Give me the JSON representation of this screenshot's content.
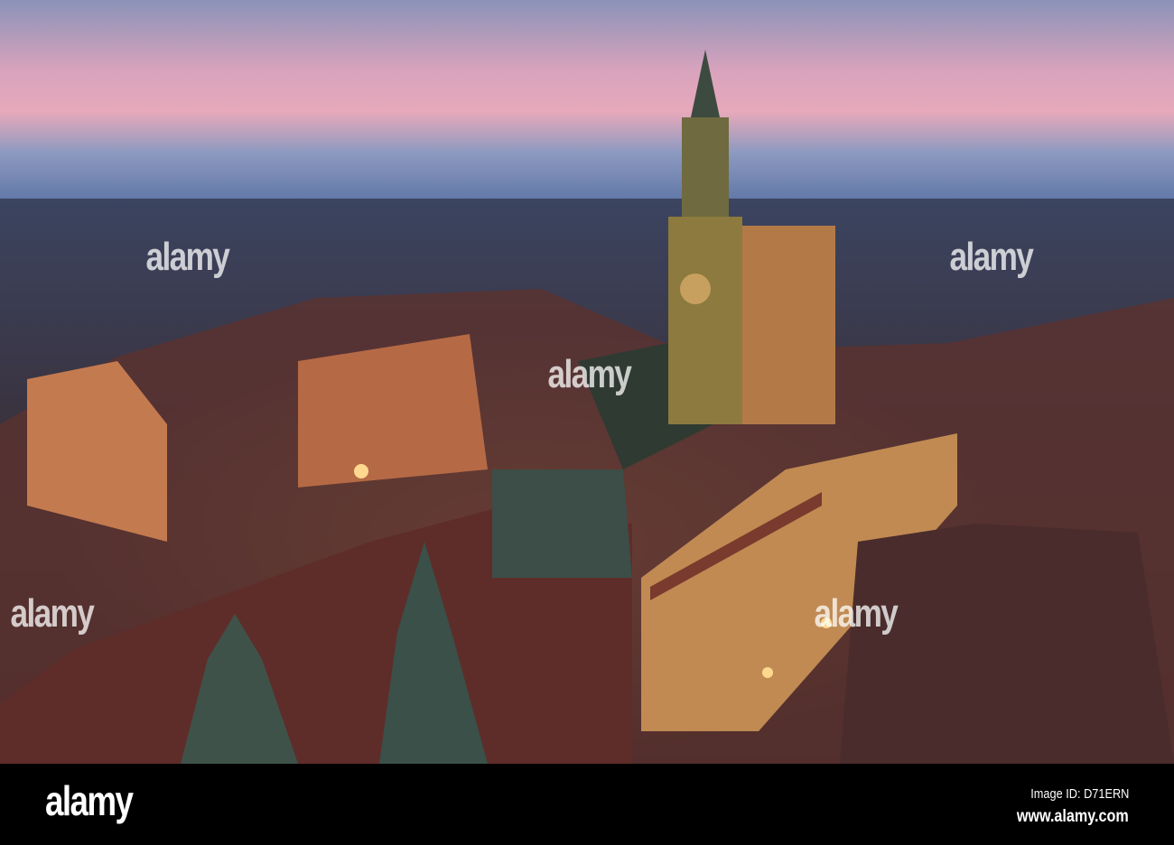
{
  "photo": {
    "subject": "Wroclaw old town at dusk with town hall tower",
    "colors": {
      "sky_top": "#7f8fb4",
      "sky_pink": "#e9a7bd",
      "horizon": "#6f86b3",
      "city": "#3a3a4a",
      "light": "#ffc56a"
    }
  },
  "watermark": {
    "text": "alamy"
  },
  "footer": {
    "logo": "alamy",
    "image_id": "Image ID: D71ERN",
    "website": "www.alamy.com"
  }
}
